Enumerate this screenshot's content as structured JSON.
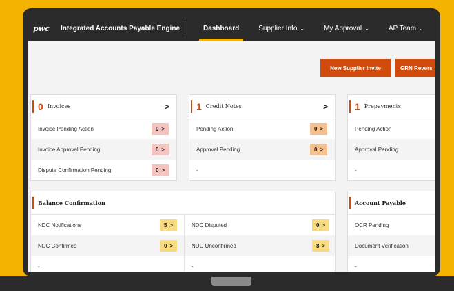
{
  "header": {
    "logo": "pwc",
    "app_title": "Integrated Accounts Payable Engine",
    "nav": [
      {
        "label": "Dashboard",
        "chevron": ""
      },
      {
        "label": "Supplier Info",
        "chevron": "⌄"
      },
      {
        "label": "My Approval",
        "chevron": "⌄"
      },
      {
        "label": "AP Team",
        "chevron": "⌄"
      }
    ]
  },
  "actions": {
    "new_supplier_invite": "New Supplier Invite",
    "grn_reversal": "GRN Revers"
  },
  "cards": {
    "invoices": {
      "count": "0",
      "title": "Invoices",
      "arrow": ">",
      "rows": [
        {
          "label": "Invoice Pending Action",
          "value": "0",
          "arrow": ">"
        },
        {
          "label": "Invoice Approval Pending",
          "value": "0",
          "arrow": ">"
        },
        {
          "label": "Dispute Confirmation Pending",
          "value": "0",
          "arrow": ">"
        }
      ]
    },
    "credit_notes": {
      "count": "1",
      "title": "Credit Notes",
      "arrow": ">",
      "rows": [
        {
          "label": "Pending Action",
          "value": "0",
          "arrow": ">"
        },
        {
          "label": "Approval Pending",
          "value": "0",
          "arrow": ">"
        },
        {
          "label": "-"
        }
      ]
    },
    "prepayments": {
      "count": "1",
      "title": "Prepayments",
      "rows": [
        {
          "label": "Pending Action"
        },
        {
          "label": "Approval Pending"
        },
        {
          "label": "-"
        }
      ]
    },
    "balance_confirmation": {
      "title": "Balance Confirmation",
      "left_rows": [
        {
          "label": "NDC Notifications",
          "value": "5",
          "arrow": ">"
        },
        {
          "label": "NDC Confirmed",
          "value": "0",
          "arrow": ">"
        },
        {
          "label": "-"
        }
      ],
      "right_rows": [
        {
          "label": "NDC Disputed",
          "value": "0",
          "arrow": ">"
        },
        {
          "label": "NDC Unconfirmed",
          "value": "8",
          "arrow": ">"
        },
        {
          "label": "-"
        }
      ]
    },
    "account_payable": {
      "title": "Account Payable",
      "rows": [
        {
          "label": "OCR Pending"
        },
        {
          "label": "Document Verification"
        },
        {
          "label": "-"
        }
      ]
    }
  }
}
